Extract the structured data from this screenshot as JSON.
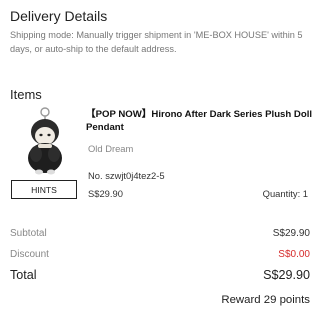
{
  "delivery": {
    "title": "Delivery Details",
    "shipping_mode": "Shipping mode: Manually trigger shipment in 'ME-BOX HOUSE' within 5 days, or auto-ship to the default address."
  },
  "items": {
    "title": "Items",
    "product": {
      "name": "【POP NOW】Hirono After Dark Series Plush Doll Pendant",
      "series": "Old Dream",
      "sku": "No. szwjt0j4tez2-5",
      "price": "S$29.90",
      "quantity": "Quantity: 1",
      "hints_label": "HINTS"
    }
  },
  "summary": {
    "subtotal_label": "Subtotal",
    "subtotal_value": "S$29.90",
    "discount_label": "Discount",
    "discount_value": "S$0.00",
    "total_label": "Total",
    "total_value": "S$29.90",
    "reward": "Reward 29 points"
  },
  "colors": {
    "discount": "#d62a2a",
    "muted_text": "#888888",
    "primary_text": "#222222"
  }
}
